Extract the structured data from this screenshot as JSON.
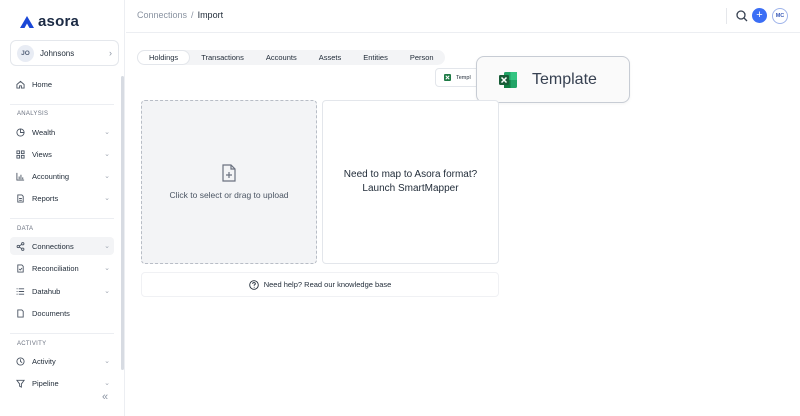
{
  "brand": {
    "name": "asora",
    "color": "#1a47d6"
  },
  "account": {
    "initials": "JO",
    "name": "Johnsons"
  },
  "sidebar": {
    "home": "Home",
    "analysis_label": "ANALYSIS",
    "analysis": [
      "Wealth",
      "Views",
      "Accounting",
      "Reports"
    ],
    "data_label": "DATA",
    "data": [
      "Connections",
      "Reconciliation",
      "Datahub",
      "Documents"
    ],
    "activity_label": "ACTIVITY",
    "activity": [
      "Activity",
      "Pipeline"
    ],
    "active_item": "Connections"
  },
  "breadcrumb": {
    "parent": "Connections",
    "separator": "/",
    "current": "Import"
  },
  "topbar": {
    "user_initials": "MC",
    "accent": "#3b6ef5"
  },
  "tabs": [
    "Holdings",
    "Transactions",
    "Accounts",
    "Assets",
    "Entities",
    "Person"
  ],
  "active_tab": "Holdings",
  "template": {
    "small_label": "Templ",
    "popover_label": "Template"
  },
  "upload": {
    "text": "Click to select or drag to upload"
  },
  "mapper": {
    "line1": "Need to map to Asora format?",
    "line2": "Launch SmartMapper"
  },
  "help": {
    "text": "Need help? Read our knowledge base"
  }
}
